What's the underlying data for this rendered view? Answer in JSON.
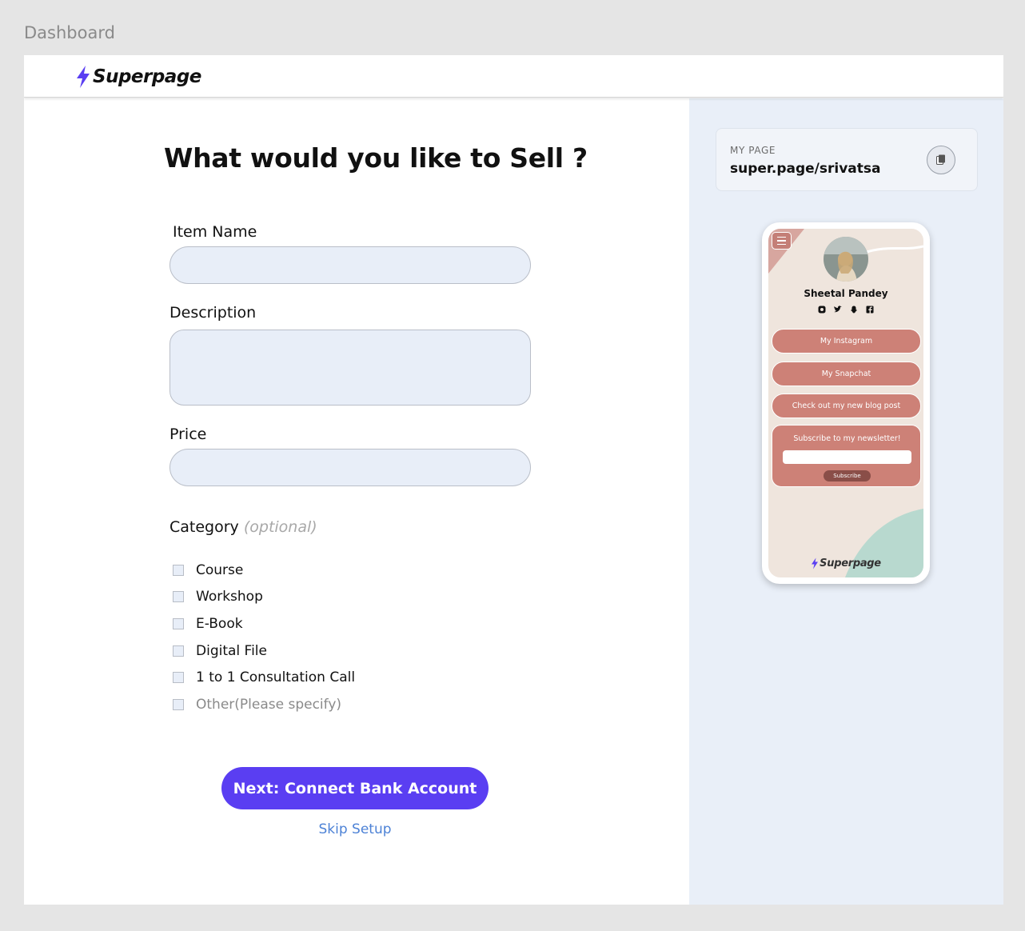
{
  "frame_label": "Dashboard",
  "brand": {
    "name": "Superpage",
    "accent": "#5a3ef2"
  },
  "form": {
    "title": "What would you like to Sell ?",
    "item_name": {
      "label": "Item Name",
      "value": ""
    },
    "description": {
      "label": "Description",
      "value": ""
    },
    "price": {
      "label": "Price",
      "value": ""
    },
    "category": {
      "label": "Category",
      "optional": "(optional)",
      "options": [
        "Course",
        "Workshop",
        "E-Book",
        "Digital File",
        "1 to 1 Consultation Call",
        "Other(Please specify)"
      ]
    },
    "next_label": "Next: Connect Bank Account",
    "skip_label": "Skip Setup"
  },
  "my_page": {
    "label": "MY PAGE",
    "url": "super.page/srivatsa"
  },
  "preview": {
    "name": "Sheetal Pandey",
    "social_icons": [
      "instagram-icon",
      "twitter-icon",
      "snapchat-icon",
      "facebook-icon"
    ],
    "links": [
      "My Instagram",
      "My Snapchat",
      "Check out my new blog post"
    ],
    "newsletter": {
      "title": "Subscribe to my newsletter!",
      "button": "Subscribe"
    },
    "brand": "Superpage",
    "colors": {
      "button": "#cd8177",
      "background": "#efe5dd",
      "accent_shape": "#b8d9cf"
    }
  }
}
